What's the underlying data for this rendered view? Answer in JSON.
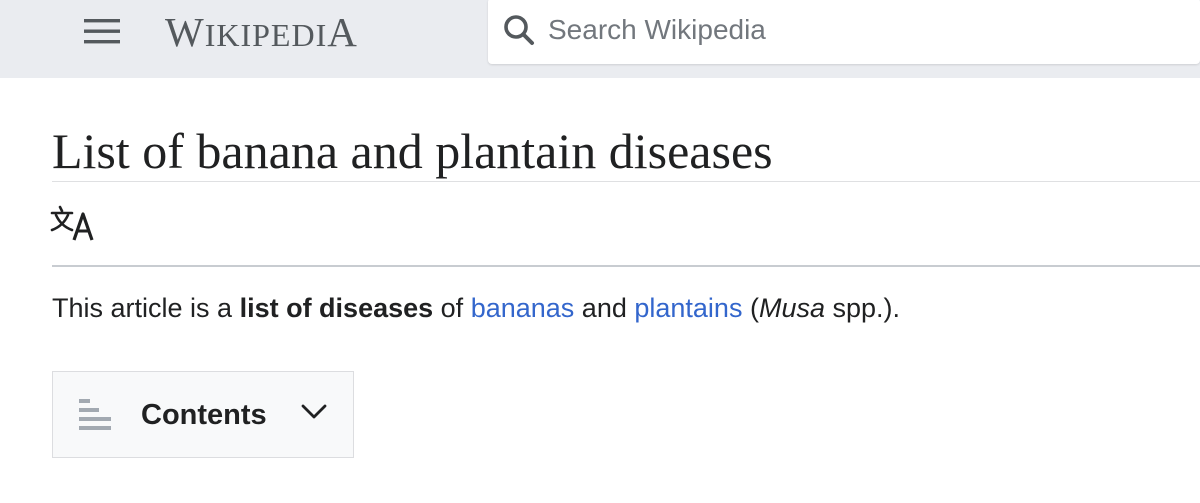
{
  "header": {
    "wordmark": {
      "w1": "W",
      "ikipedi": "IKIPEDI",
      "a": "A"
    },
    "search": {
      "placeholder": "Search Wikipedia"
    }
  },
  "article": {
    "title": "List of banana and plantain diseases",
    "intro": {
      "before": "This article is a ",
      "bold": "list of diseases",
      "mid1": " of ",
      "link1": "bananas",
      "mid2": " and ",
      "link2": "plantains",
      "mid3": " (",
      "italic": "Musa",
      "after": " spp.)."
    },
    "toc": {
      "label": "Contents"
    }
  },
  "colors": {
    "header_bg": "#eaecf0",
    "link": "#3366cc",
    "text": "#202122",
    "muted": "#54595d"
  }
}
